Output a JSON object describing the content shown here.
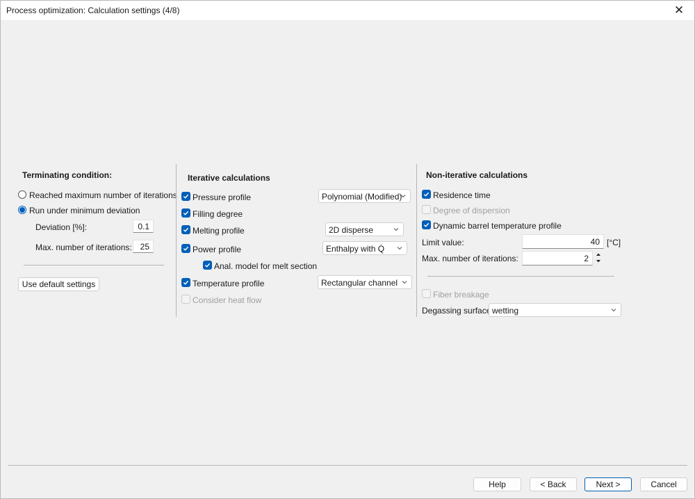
{
  "window": {
    "title": "Process optimization: Calculation settings (4/8)",
    "close_glyph": "✕"
  },
  "terminating": {
    "heading": "Terminating condition:",
    "radio_max_iter": "Reached maximum number of iterations",
    "radio_min_dev": "Run under minimum deviation",
    "selected": "min_deviation",
    "deviation_label": "Deviation [%]:",
    "deviation_value": "0.1",
    "max_iter_label": "Max. number of iterations:",
    "max_iter_value": "25",
    "default_button": "Use default settings"
  },
  "iterative": {
    "heading": "Iterative calculations",
    "pressure_label": "Pressure profile",
    "pressure_checked": true,
    "pressure_option": "Polynomial (Modified)",
    "filling_label": "Filling degree",
    "filling_checked": true,
    "melting_label": "Melting profile",
    "melting_checked": true,
    "melting_option": "2D disperse",
    "power_label": "Power profile",
    "power_checked": true,
    "power_option": "Enthalpy with Q̇",
    "anal_label": "Anal. model for melt section",
    "anal_checked": true,
    "temperature_label": "Temperature profile",
    "temperature_checked": true,
    "temperature_option": "Rectangular channel",
    "heatflow_label": "Consider heat flow",
    "heatflow_checked": false
  },
  "noniterative": {
    "heading": "Non-iterative calculations",
    "residence_label": "Residence time",
    "residence_checked": true,
    "dispersion_label": "Degree of dispersion",
    "dispersion_checked": false,
    "dynamic_label": "Dynamic barrel temperature profile",
    "dynamic_checked": true,
    "limit_label": "Limit value:",
    "limit_value": "40",
    "limit_unit": "[°C]",
    "max_iter_label": "Max. number of iterations:",
    "max_iter_value": "2",
    "fiber_label": "Fiber breakage",
    "fiber_checked": false,
    "degassing_label": "Degassing surface",
    "degassing_option": "wetting"
  },
  "footer": {
    "help": "Help",
    "back": "< Back",
    "next": "Next >",
    "cancel": "Cancel"
  },
  "colors": {
    "accent": "#005fb8",
    "background": "#f0f0f0"
  }
}
